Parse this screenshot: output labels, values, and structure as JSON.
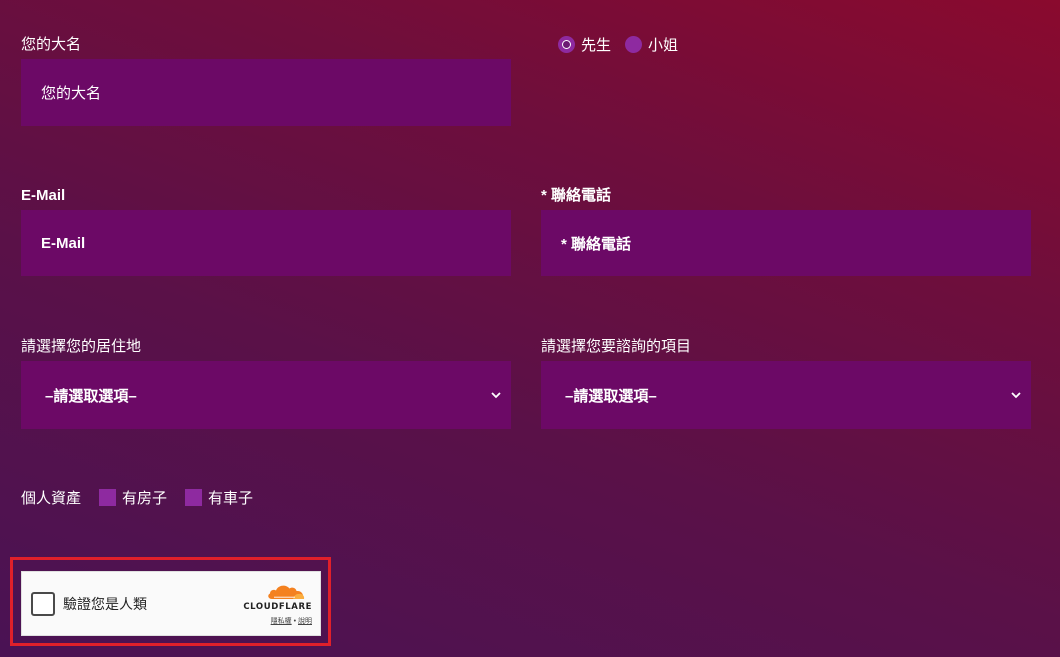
{
  "form": {
    "name": {
      "label": "您的大名",
      "placeholder": "您的大名"
    },
    "gender": {
      "options": [
        {
          "label": "先生",
          "checked": true
        },
        {
          "label": "小姐",
          "checked": false
        }
      ]
    },
    "email": {
      "label": "E-Mail",
      "placeholder": "E-Mail"
    },
    "phone": {
      "label": "* 聯絡電話",
      "placeholder": "* 聯絡電話"
    },
    "residence": {
      "label": "請選擇您的居住地",
      "selected": "–請選取選項–"
    },
    "consult_item": {
      "label": "請選擇您要諮詢的項目",
      "selected": "–請選取選項–"
    },
    "assets": {
      "label": "個人資產",
      "options": [
        {
          "label": "有房子",
          "checked": false
        },
        {
          "label": "有車子",
          "checked": false
        }
      ]
    }
  },
  "turnstile": {
    "prompt": "驗證您是人類",
    "brand": "CLOUDFLARE",
    "privacy": "隱私權",
    "separator": "•",
    "help": "說明"
  },
  "colors": {
    "field_bg": "#6c0966",
    "accent_purple": "#8e2aa0",
    "highlight_border": "#e0202a",
    "cloudflare_orange": "#f48120"
  },
  "icons": {
    "select_chevron": "chevron-down-icon",
    "brand_logo": "cloudflare-cloud-icon"
  }
}
